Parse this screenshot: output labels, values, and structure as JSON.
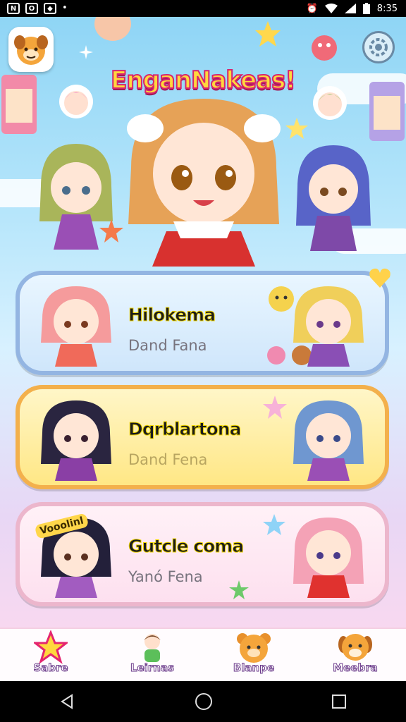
{
  "status_bar": {
    "time": "8:35",
    "icons": [
      "notification-icon-1",
      "notification-icon-2",
      "notification-icon-3",
      "dot-icon",
      "alarm-icon",
      "wifi-icon",
      "signal-icon",
      "battery-icon"
    ]
  },
  "header": {
    "title": "EnganNakeas!",
    "logo_icon": "dog-face-icon",
    "settings_icon": "settings-icon"
  },
  "cards": [
    {
      "title": "Hilokema",
      "subtitle": "Dand Fana"
    },
    {
      "title": "Dqrblartona",
      "subtitle": "Dand Fena"
    },
    {
      "title": "Gutcle coma",
      "subtitle": "Yanó Fena"
    }
  ],
  "card3_badge": "Vooolinl",
  "bottom_nav": [
    {
      "label": "Sabre",
      "icon": "star-icon"
    },
    {
      "label": "Leirnas",
      "icon": "character-icon"
    },
    {
      "label": "Blanpe",
      "icon": "bear-icon"
    },
    {
      "label": "Meebra",
      "icon": "dog-icon"
    }
  ],
  "colors": {
    "title_fill": "#ffd83d",
    "title_stroke": "#d6246e",
    "card1_border": "#93b5e2",
    "card2_border": "#f3b04c",
    "card3_border": "#ecb6cc"
  }
}
